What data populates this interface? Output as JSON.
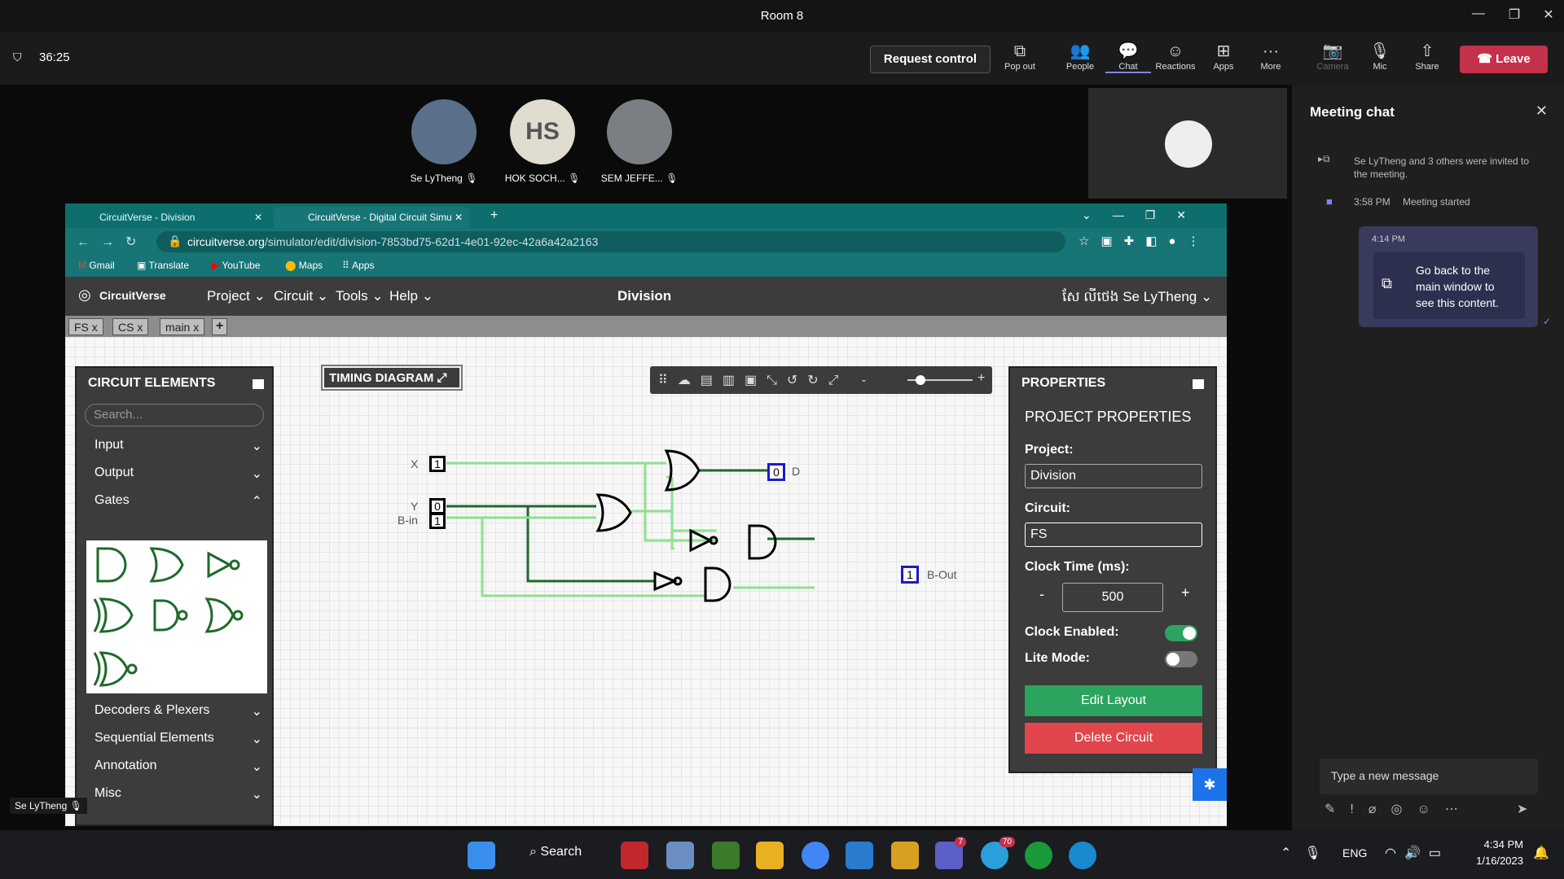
{
  "meeting": {
    "title": "Room 8",
    "timer": "36:25",
    "request_control": "Request control",
    "leave": "Leave",
    "buttons": {
      "popout": "Pop out",
      "people": "People",
      "chat": "Chat",
      "reactions": "Reactions",
      "apps": "Apps",
      "more": "More",
      "camera": "Camera",
      "mic": "Mic",
      "share": "Share"
    },
    "participants": [
      {
        "name": "Se LyTheng"
      },
      {
        "name": "HOK SOCH...",
        "initials": "HS"
      },
      {
        "name": "SEM JEFFE..."
      }
    ],
    "self_label": "Se LyTheng"
  },
  "chat": {
    "title": "Meeting chat",
    "invite": "Se LyTheng and 3 others were invited to the meeting.",
    "started_time": "3:58 PM",
    "started_text": "Meeting started",
    "msg_time": "4:14 PM",
    "msg_text": "Go back to the main window to see this content.",
    "placeholder": "Type a new message"
  },
  "browser": {
    "tabs": [
      "CircuitVerse - Division",
      "CircuitVerse - Digital Circuit Simu"
    ],
    "url_host": "circuitverse.org",
    "url_path": "/simulator/edit/division-7853bd75-62d1-4e01-92ec-42a6a42a2163",
    "bookmarks": [
      "Gmail",
      "Translate",
      "YouTube",
      "Maps",
      "Apps"
    ]
  },
  "cv": {
    "logo": "CircuitVerse",
    "menu": [
      "Project",
      "Circuit",
      "Tools",
      "Help"
    ],
    "project_name": "Division",
    "user": "សែ លីថេង Se LyTheng",
    "circuit_tabs": [
      "FS",
      "CS",
      "main"
    ],
    "timing": "TIMING DIAGRAM",
    "elements": {
      "title": "CIRCUIT ELEMENTS",
      "search_placeholder": "Search...",
      "categories": [
        "Input",
        "Output",
        "Gates",
        "Decoders & Plexers",
        "Sequential Elements",
        "Annotation",
        "Misc"
      ]
    },
    "properties": {
      "title": "PROPERTIES",
      "subtitle": "PROJECT PROPERTIES",
      "project_label": "Project:",
      "project_value": "Division",
      "circuit_label": "Circuit:",
      "circuit_value": "FS",
      "clock_label": "Clock Time (ms):",
      "clock_value": "500",
      "minus": "-",
      "plus": "+",
      "clock_enabled": "Clock Enabled:",
      "lite_mode": "Lite Mode:",
      "edit_layout": "Edit Layout",
      "delete_circuit": "Delete Circuit"
    },
    "circuit": {
      "x_label": "X",
      "x_val": "1",
      "y_label": "Y",
      "y_val": "0",
      "bin_label": "B-in",
      "bin_val": "1",
      "d_val": "0",
      "d_label": "D",
      "bout_val": "1",
      "bout_label": "B-Out"
    }
  },
  "taskbar": {
    "search": "Search",
    "lang": "ENG",
    "time": "4:34 PM",
    "date": "1/16/2023",
    "teams_badge": "7",
    "telegram_badge": "70"
  },
  "colors": {
    "accent_red": "#c4314b",
    "teal": "#0e6e6e",
    "green_btn": "#2ba45f",
    "red_btn": "#e0464c",
    "wire_on": "#1e8a2e",
    "wire_off": "#8fe08f"
  }
}
